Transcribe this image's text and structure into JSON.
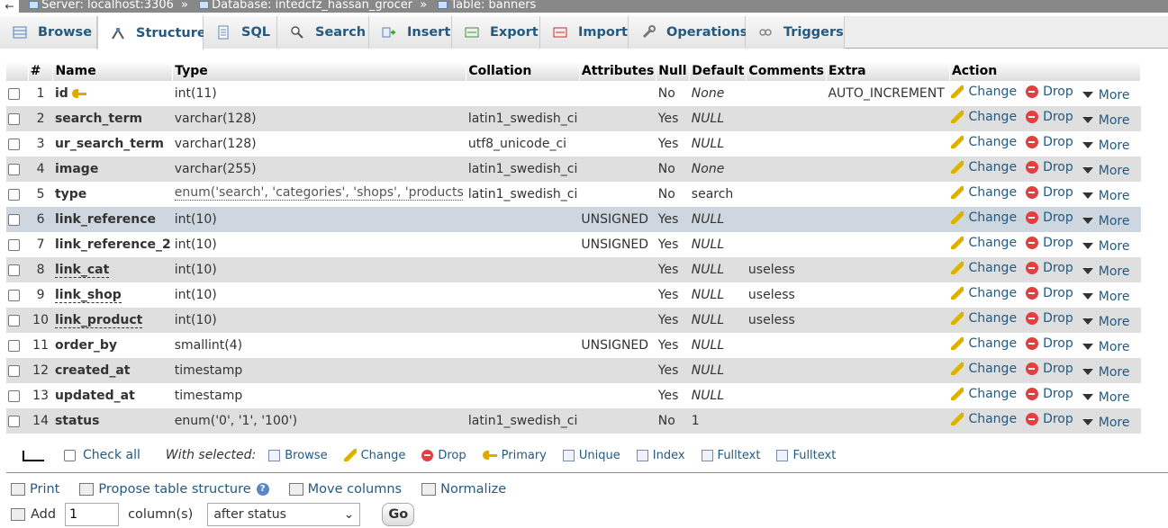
{
  "breadcrumb": {
    "back": "←",
    "server": "Server: localhost:3306",
    "database": "Database: intedcfz_hassan_grocer",
    "table": "Table: banners",
    "sep": "»"
  },
  "tabs": [
    {
      "label": "Browse",
      "icon": "browse-icon"
    },
    {
      "label": "Structure",
      "icon": "structure-icon"
    },
    {
      "label": "SQL",
      "icon": "sql-icon"
    },
    {
      "label": "Search",
      "icon": "search-icon"
    },
    {
      "label": "Insert",
      "icon": "insert-icon"
    },
    {
      "label": "Export",
      "icon": "export-icon"
    },
    {
      "label": "Import",
      "icon": "import-icon"
    },
    {
      "label": "Operations",
      "icon": "operations-icon"
    },
    {
      "label": "Triggers",
      "icon": "triggers-icon"
    }
  ],
  "columns": {
    "num": "#",
    "name": "Name",
    "type": "Type",
    "collation": "Collation",
    "attributes": "Attributes",
    "null": "Null",
    "default": "Default",
    "comments": "Comments",
    "extra": "Extra",
    "action": "Action"
  },
  "actions": {
    "change": "Change",
    "drop": "Drop",
    "more": "More"
  },
  "rows": [
    {
      "num": "1",
      "name": "id",
      "type": "int(11)",
      "collation": "",
      "attributes": "",
      "null": "No",
      "default": "None",
      "comments": "",
      "extra": "AUTO_INCREMENT"
    },
    {
      "num": "2",
      "name": "search_term",
      "type": "varchar(128)",
      "collation": "latin1_swedish_ci",
      "attributes": "",
      "null": "Yes",
      "default": "NULL",
      "comments": "",
      "extra": ""
    },
    {
      "num": "3",
      "name": "ur_search_term",
      "type": "varchar(128)",
      "collation": "utf8_unicode_ci",
      "attributes": "",
      "null": "Yes",
      "default": "NULL",
      "comments": "",
      "extra": ""
    },
    {
      "num": "4",
      "name": "image",
      "type": "varchar(255)",
      "collation": "latin1_swedish_ci",
      "attributes": "",
      "null": "No",
      "default": "None",
      "comments": "",
      "extra": ""
    },
    {
      "num": "5",
      "name": "type",
      "type": "enum('search', 'categories', 'shops', 'products',...",
      "collation": "latin1_swedish_ci",
      "attributes": "",
      "null": "No",
      "default": "search",
      "comments": "",
      "extra": ""
    },
    {
      "num": "6",
      "name": "link_reference",
      "type": "int(10)",
      "collation": "",
      "attributes": "UNSIGNED",
      "null": "Yes",
      "default": "NULL",
      "comments": "",
      "extra": ""
    },
    {
      "num": "7",
      "name": "link_reference_2",
      "type": "int(10)",
      "collation": "",
      "attributes": "UNSIGNED",
      "null": "Yes",
      "default": "NULL",
      "comments": "",
      "extra": ""
    },
    {
      "num": "8",
      "name": "link_cat",
      "type": "int(10)",
      "collation": "",
      "attributes": "",
      "null": "Yes",
      "default": "NULL",
      "comments": "useless",
      "extra": ""
    },
    {
      "num": "9",
      "name": "link_shop",
      "type": "int(10)",
      "collation": "",
      "attributes": "",
      "null": "Yes",
      "default": "NULL",
      "comments": "useless",
      "extra": ""
    },
    {
      "num": "10",
      "name": "link_product",
      "type": "int(10)",
      "collation": "",
      "attributes": "",
      "null": "Yes",
      "default": "NULL",
      "comments": "useless",
      "extra": ""
    },
    {
      "num": "11",
      "name": "order_by",
      "type": "smallint(4)",
      "collation": "",
      "attributes": "UNSIGNED",
      "null": "Yes",
      "default": "NULL",
      "comments": "",
      "extra": ""
    },
    {
      "num": "12",
      "name": "created_at",
      "type": "timestamp",
      "collation": "",
      "attributes": "",
      "null": "Yes",
      "default": "NULL",
      "comments": "",
      "extra": ""
    },
    {
      "num": "13",
      "name": "updated_at",
      "type": "timestamp",
      "collation": "",
      "attributes": "",
      "null": "Yes",
      "default": "NULL",
      "comments": "",
      "extra": ""
    },
    {
      "num": "14",
      "name": "status",
      "type": "enum('0', '1', '100')",
      "collation": "latin1_swedish_ci",
      "attributes": "",
      "null": "No",
      "default": "1",
      "comments": "",
      "extra": ""
    }
  ],
  "bulk": {
    "check_all": "Check all",
    "with_selected": "With selected:",
    "buttons": [
      "Browse",
      "Change",
      "Drop",
      "Primary",
      "Unique",
      "Index",
      "Fulltext",
      "Fulltext"
    ]
  },
  "tools": {
    "print": "Print",
    "propose": "Propose table structure",
    "move": "Move columns",
    "normalize": "Normalize"
  },
  "add": {
    "label": "Add",
    "count": "1",
    "columns_label": "column(s)",
    "position": "after status",
    "go": "Go"
  }
}
